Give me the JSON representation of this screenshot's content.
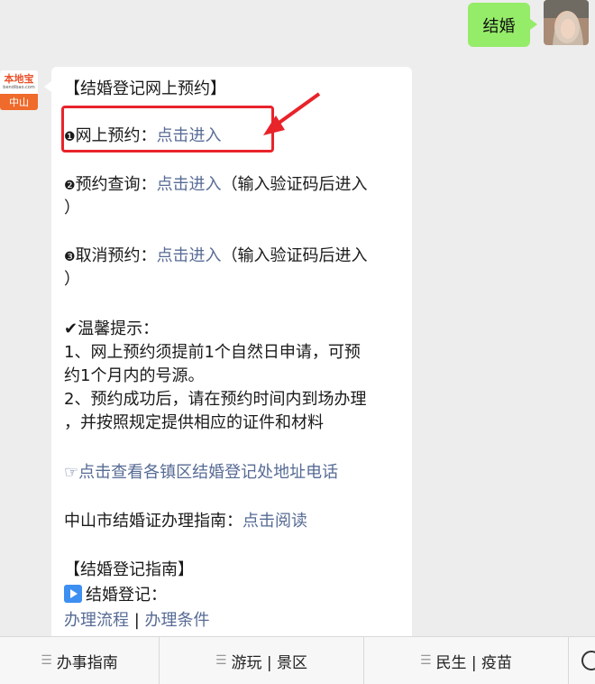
{
  "outgoing": {
    "text": "结婚"
  },
  "bot": {
    "logo_text": "本地宝",
    "logo_sub": "bendibao.com",
    "logo_city": "中山"
  },
  "message": {
    "title": "【结婚登记网上预约】",
    "item1": {
      "bullet": "❶",
      "label": "网上预约：",
      "link": "点击进入"
    },
    "item2": {
      "bullet": "❷",
      "label": "预约查询：",
      "link": "点击进入",
      "note_a": "（输入验证码后进入",
      "note_b": "）"
    },
    "item3": {
      "bullet": "❸",
      "label": "取消预约：",
      "link": "点击进入",
      "note_a": "（输入验证码后进入",
      "note_b": "）"
    },
    "tips_title": "✔温馨提示：",
    "tips": [
      "1、网上预约须提前1个自然日申请，可预",
      "约1个月内的号源。",
      "2、预约成功后，请在预约时间内到场办理",
      "，并按照规定提供相应的证件和材料"
    ],
    "address_link": "☞点击查看各镇区结婚登记处地址电话",
    "guide_label": "中山市结婚证办理指南：",
    "guide_link": "点击阅读",
    "guide_title": "【结婚登记指南】",
    "sub_title": "结婚登记：",
    "link_flow": "办理流程",
    "divider": " | ",
    "link_cond": "办理条件"
  },
  "menu": {
    "items": [
      "办事指南",
      "游玩 | 景区",
      "民生 | 疫苗"
    ],
    "burger": "☰"
  },
  "colors": {
    "bubble_out": "#95ec69",
    "link": "#576b95",
    "highlight": "#e8232a",
    "bg": "#ededed"
  }
}
